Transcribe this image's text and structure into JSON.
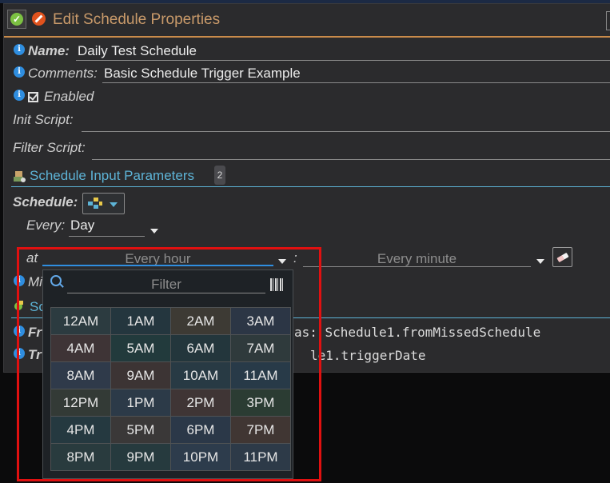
{
  "dialog": {
    "title": "Edit Schedule Properties"
  },
  "fields": {
    "name_label": "Name:",
    "name_value": "Daily Test Schedule",
    "comments_label": "Comments:",
    "comments_value": "Basic Schedule Trigger Example",
    "enabled_label": "Enabled",
    "enabled_checked": true,
    "init_script_label": "Init Script:",
    "init_script_value": "",
    "filter_script_label": "Filter Script:",
    "filter_script_value": ""
  },
  "section": {
    "title": "Schedule Input Parameters",
    "count": "2"
  },
  "schedule": {
    "label": "Schedule:",
    "every_label": "Every:",
    "every_value": "Day",
    "at_label": "at",
    "hour_placeholder": "Every hour",
    "colon": ":",
    "minute_placeholder": "Every minute"
  },
  "partial_rows": {
    "row1_label": "Mi",
    "row2_section": "Sc",
    "row3_label": "Fr",
    "row3_value": "as: Schedule1.fromMissedSchedule",
    "row4_label": "Tr",
    "row4_value": "le1.triggerDate"
  },
  "dropdown": {
    "filter_placeholder": "Filter",
    "hours": [
      "12AM",
      "1AM",
      "2AM",
      "3AM",
      "4AM",
      "5AM",
      "6AM",
      "7AM",
      "8AM",
      "9AM",
      "10AM",
      "11AM",
      "12PM",
      "1PM",
      "2PM",
      "3PM",
      "4PM",
      "5PM",
      "6PM",
      "7PM",
      "8PM",
      "9PM",
      "10PM",
      "11PM"
    ],
    "cell_colors": [
      "#2c3b40",
      "#24363e",
      "#3d3a34",
      "#2c3645",
      "#3e3436",
      "#223a3c",
      "#23363c",
      "#2f3a3c",
      "#2f3a4a",
      "#3c3434",
      "#283a44",
      "#283a48",
      "#333a36",
      "#2c3a48",
      "#3f3535",
      "#2b3c33",
      "#253940",
      "#3a3838",
      "#2b3848",
      "#403633",
      "#293b3e",
      "#263a3e",
      "#2d3c4c",
      "#2d3a48"
    ]
  },
  "colors": {
    "accent_orange": "#c98b4a",
    "teal": "#5db3d6",
    "info_blue": "#2f8ee0",
    "highlight_red": "#e01010"
  }
}
